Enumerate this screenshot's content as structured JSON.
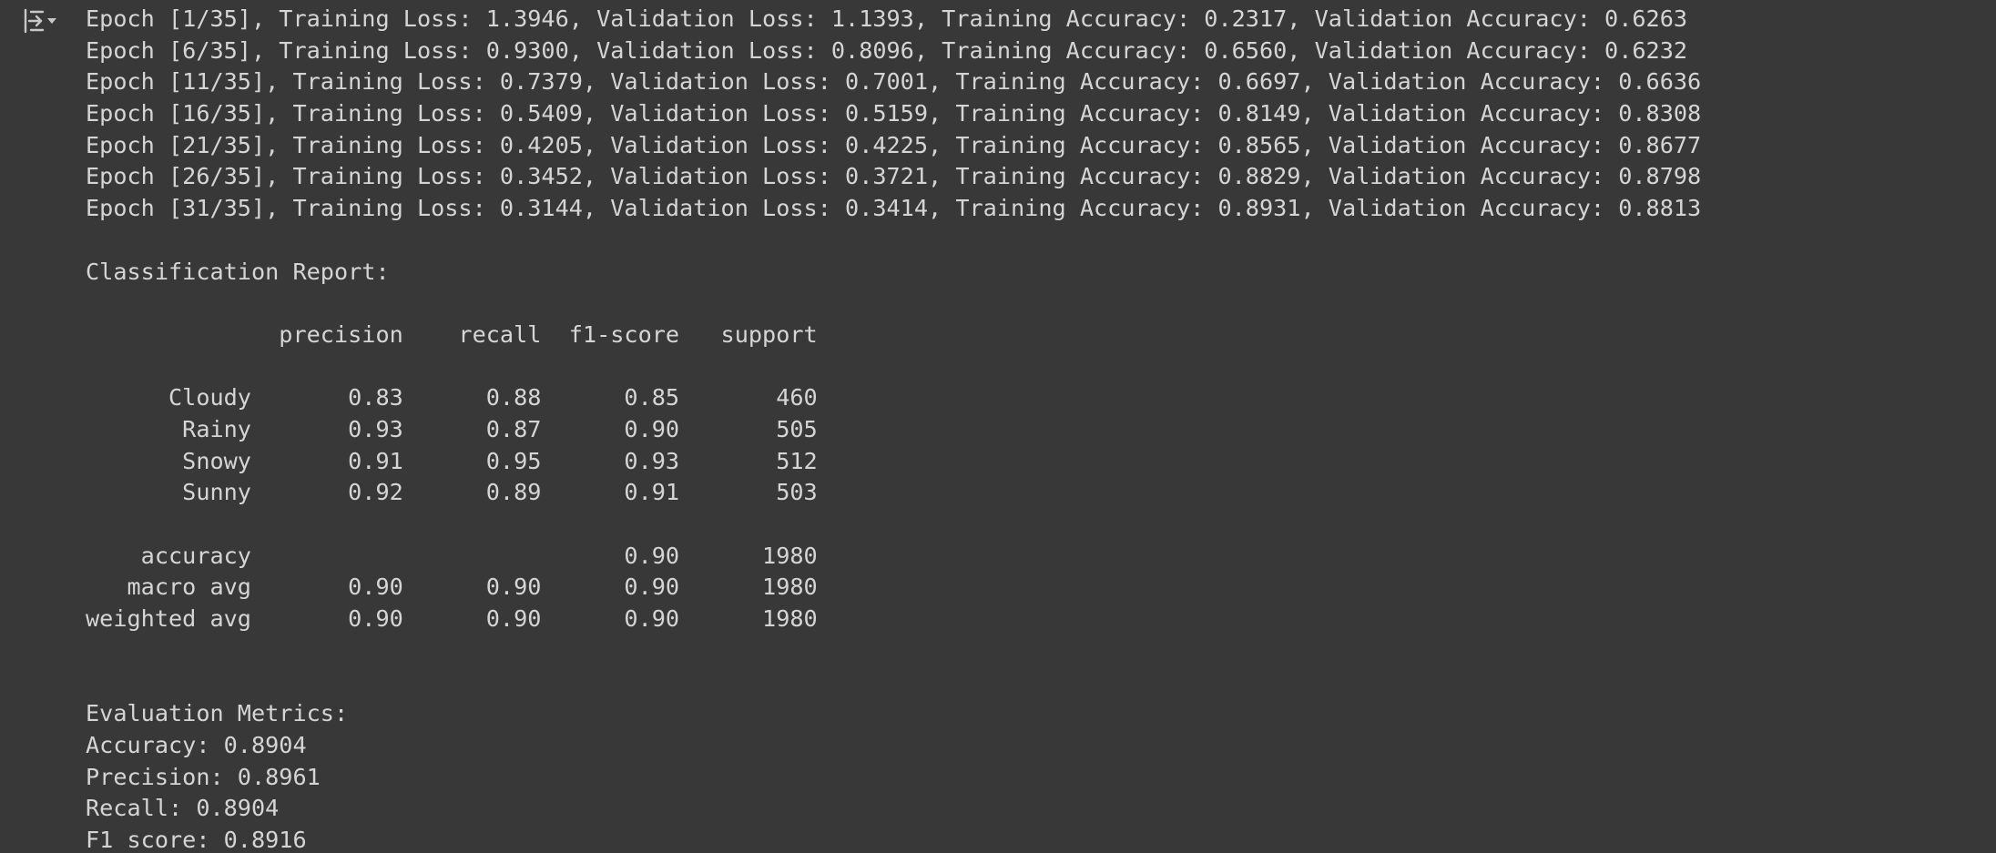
{
  "output": {
    "lines": [
      "Epoch [1/35], Training Loss: 1.3946, Validation Loss: 1.1393, Training Accuracy: 0.2317, Validation Accuracy: 0.6263",
      "Epoch [6/35], Training Loss: 0.9300, Validation Loss: 0.8096, Training Accuracy: 0.6560, Validation Accuracy: 0.6232",
      "Epoch [11/35], Training Loss: 0.7379, Validation Loss: 0.7001, Training Accuracy: 0.6697, Validation Accuracy: 0.6636",
      "Epoch [16/35], Training Loss: 0.5409, Validation Loss: 0.5159, Training Accuracy: 0.8149, Validation Accuracy: 0.8308",
      "Epoch [21/35], Training Loss: 0.4205, Validation Loss: 0.4225, Training Accuracy: 0.8565, Validation Accuracy: 0.8677",
      "Epoch [26/35], Training Loss: 0.3452, Validation Loss: 0.3721, Training Accuracy: 0.8829, Validation Accuracy: 0.8798",
      "Epoch [31/35], Training Loss: 0.3144, Validation Loss: 0.3414, Training Accuracy: 0.8931, Validation Accuracy: 0.8813",
      "",
      "Classification Report:",
      "",
      "              precision    recall  f1-score   support",
      "",
      "      Cloudy       0.83      0.88      0.85       460",
      "       Rainy       0.93      0.87      0.90       505",
      "       Snowy       0.91      0.95      0.93       512",
      "       Sunny       0.92      0.89      0.91       503",
      "",
      "    accuracy                           0.90      1980",
      "   macro avg       0.90      0.90      0.90      1980",
      "weighted avg       0.90      0.90      0.90      1980",
      "",
      "",
      "Evaluation Metrics:",
      "Accuracy: 0.8904",
      "Precision: 0.8961",
      "Recall: 0.8904",
      "F1_score: 0.8916"
    ]
  },
  "icons": {
    "output_toggle": "output-collapse-icon"
  },
  "colors": {
    "background": "#383838",
    "text": "#d5d5d5",
    "icon": "#c8c8c8"
  }
}
